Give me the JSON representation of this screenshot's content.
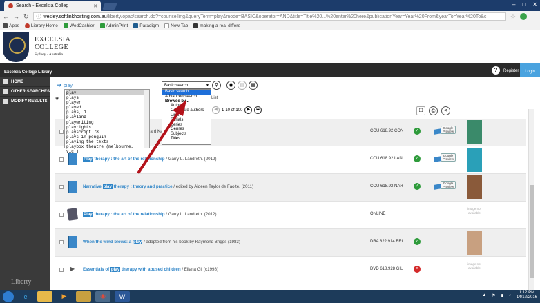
{
  "browser": {
    "tab_title": "Search - Excelsia Colleg",
    "url_domain": "wesley.softlinkhosting.com.au",
    "url_rest": "/liberty/opac/search.do?=counselling&queryTerm=play&mode=BASIC&operator=AND&title=Title%20...%20enter%20here&publicationYear=Year%20From&yearTo=Year%20To&c",
    "bookmarks": [
      "Apps",
      "Library Home",
      "WedCashier",
      "AdminPrint",
      "Paradigm",
      "New Tab",
      "making a real differe"
    ]
  },
  "header": {
    "college_line1": "Excelsia",
    "college_line2": "College",
    "college_sub": "Sydney · Australia",
    "library_name": "Excelsia College Library",
    "register": "Register",
    "login": "Login"
  },
  "sidebar": {
    "items": [
      {
        "label": "HOME"
      },
      {
        "label": "OTHER SEARCHES"
      },
      {
        "label": "MODIFY RESULTS"
      }
    ],
    "brand": "Liberty"
  },
  "search": {
    "query": "play",
    "select_value": "Basic search",
    "autocomplete": [
      "play",
      "plays",
      "player",
      "played",
      "plays, 1",
      "playland",
      "playwriting",
      "playrights",
      "playscript 78",
      "plays in penguin",
      "playing the texts",
      "playbox theatre (melbourne, vic.)"
    ],
    "dropdown": [
      {
        "label": "Basic search",
        "style": "hl"
      },
      {
        "label": "Advanced search",
        "style": ""
      },
      {
        "label": "Browse by...",
        "style": "bold"
      },
      {
        "label": "Authors",
        "style": "indent"
      },
      {
        "label": "Corporate authors",
        "style": "indent"
      },
      {
        "label": "Lists",
        "style": "indent"
      },
      {
        "label": "Serials",
        "style": "indent"
      },
      {
        "label": "Series",
        "style": "indent"
      },
      {
        "label": "Genres",
        "style": "indent"
      },
      {
        "label": "Subjects",
        "style": "indent"
      },
      {
        "label": "Titles",
        "style": "indent"
      }
    ],
    "pager_text": "1-10 of 100",
    "list_label": "List"
  },
  "results": [
    {
      "format": "book",
      "title_rest": "by Charles E. Schaefer & Heidi Gerard Kaduson  (2006, 2008)",
      "title_html": "",
      "call": "COU 618.92 CON",
      "status": "ok",
      "preview": true,
      "cover": "#3a8a6a"
    },
    {
      "format": "book",
      "title_pre": "",
      "hl": "Play",
      "title_mid": " therapy : the art of the relationship",
      "author": " / Garry L. Landreth.  (2012)",
      "call": "COU 618.92 LAN",
      "status": "ok",
      "preview": true,
      "cover": "#2aa0b8"
    },
    {
      "format": "book",
      "title_pre": "Narrative ",
      "hl": "play",
      "title_mid": " therapy : theory and practice",
      "author": " / edited by Aideen Taylor de Faoite.  (2011)",
      "call": "COU 618.92 NAR",
      "status": "ok",
      "preview": true,
      "cover": "#8a5a3a"
    },
    {
      "format": "ebook",
      "title_pre": "",
      "hl": "Play",
      "title_mid": " therapy : the art of the relationship",
      "author": " / Garry L. Landreth.  (2012)",
      "call": "ONLINE",
      "status": "",
      "preview": false,
      "cover": ""
    },
    {
      "format": "book",
      "title_pre": "When the wind blows: a ",
      "hl": "play",
      "title_mid": "",
      "author": " / adapted from his book by Raymond Briggs  (1983)",
      "call": "DRA 822.914 BRI",
      "status": "ok",
      "preview": false,
      "cover": "#c8a080"
    },
    {
      "format": "dvd",
      "title_pre": "Essentials of ",
      "hl": "play",
      "title_mid": " therapy with abused children",
      "author": " / Eliana Gil  (c1998)",
      "call": "DVD 618.928 GIL",
      "status": "no",
      "preview": false,
      "cover": ""
    }
  ],
  "labels": {
    "google_preview": "Google Preview",
    "image_not_available": "image not available"
  },
  "taskbar": {
    "time": "1:12 PM",
    "date": "14/12/2016"
  }
}
